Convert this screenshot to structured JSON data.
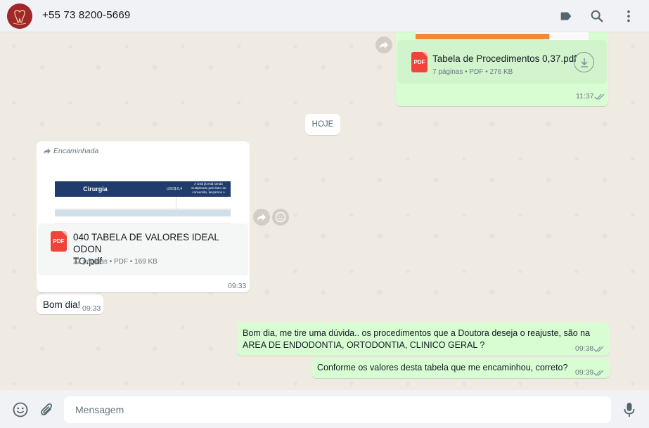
{
  "header": {
    "contact_name": "+55 73 8200-5669"
  },
  "chat": {
    "date_separator": "HOJE",
    "messages": [
      {
        "type": "document",
        "direction": "outgoing",
        "file_name": "Tabela de Procedimentos 0,37.pdf",
        "meta": "7 páginas • PDF • 276 KB",
        "time": "11:37"
      },
      {
        "type": "document",
        "direction": "incoming",
        "forwarded_label": "Encaminhada",
        "file_name": "040 TABELA DE VALORES IDEAL ODONTO.pdf",
        "file_name_line1": "040 TABELA DE VALORES IDEAL ODON",
        "file_name_line2": "TO.pdf",
        "meta": "22 páginas • PDF • 169 KB",
        "time": "09:33",
        "thumbnail": {
          "title": "Cirurgia",
          "header_mid": "USO$ 0,4",
          "header_right": "A US$ já está sendo multiplicado pelo fator de conversão, lançamos o"
        }
      },
      {
        "type": "text",
        "direction": "incoming",
        "text": "Bom dia!",
        "time": "09:33"
      },
      {
        "type": "text",
        "direction": "outgoing",
        "text_line1": "Bom dia, me tire uma dúvida.. os procedimentos que a Doutora deseja o reajuste, são na",
        "text_line2": "AREA DE ENDODONTIA, ORTODONTIA, CLINICO GERAL ?",
        "time": "09:38"
      },
      {
        "type": "text",
        "direction": "outgoing",
        "text": "Conforme os valores desta tabela que me encaminhou, correto?",
        "time": "09:39"
      }
    ]
  },
  "footer": {
    "placeholder": "Mensagem"
  },
  "icons": {
    "header": [
      "label-icon",
      "search-icon",
      "menu-icon"
    ],
    "footer": [
      "emoji-icon",
      "attach-icon",
      "mic-icon"
    ],
    "pdf_badge": "PDF"
  },
  "colors": {
    "outgoing_bubble": "#d9fdd3",
    "incoming_bubble": "#ffffff",
    "chat_background": "#efeae2",
    "pdf_red": "#f2433b",
    "read_ticks": "#8696a0"
  }
}
